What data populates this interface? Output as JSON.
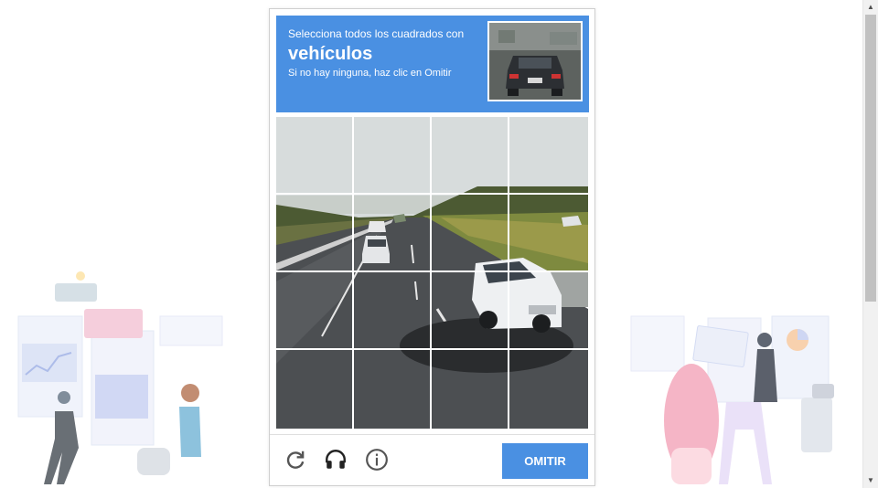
{
  "challenge": {
    "instruction": "Selecciona todos los cuadrados con",
    "target": "vehículos",
    "hint": "Si no hay ninguna, haz clic en Omitir",
    "header_color": "#4a90e2"
  },
  "grid": {
    "rows": 4,
    "cols": 4,
    "tiles": [
      {
        "id": "r1c1"
      },
      {
        "id": "r1c2"
      },
      {
        "id": "r1c3"
      },
      {
        "id": "r1c4"
      },
      {
        "id": "r2c1"
      },
      {
        "id": "r2c2"
      },
      {
        "id": "r2c3"
      },
      {
        "id": "r2c4"
      },
      {
        "id": "r3c1"
      },
      {
        "id": "r3c2"
      },
      {
        "id": "r3c3"
      },
      {
        "id": "r3c4"
      },
      {
        "id": "r4c1"
      },
      {
        "id": "r4c2"
      },
      {
        "id": "r4c3"
      },
      {
        "id": "r4c4"
      }
    ]
  },
  "footer": {
    "reload_icon": "reload-icon",
    "audio_icon": "headphones-icon",
    "info_icon": "info-icon",
    "skip_label": "OMITIR"
  }
}
